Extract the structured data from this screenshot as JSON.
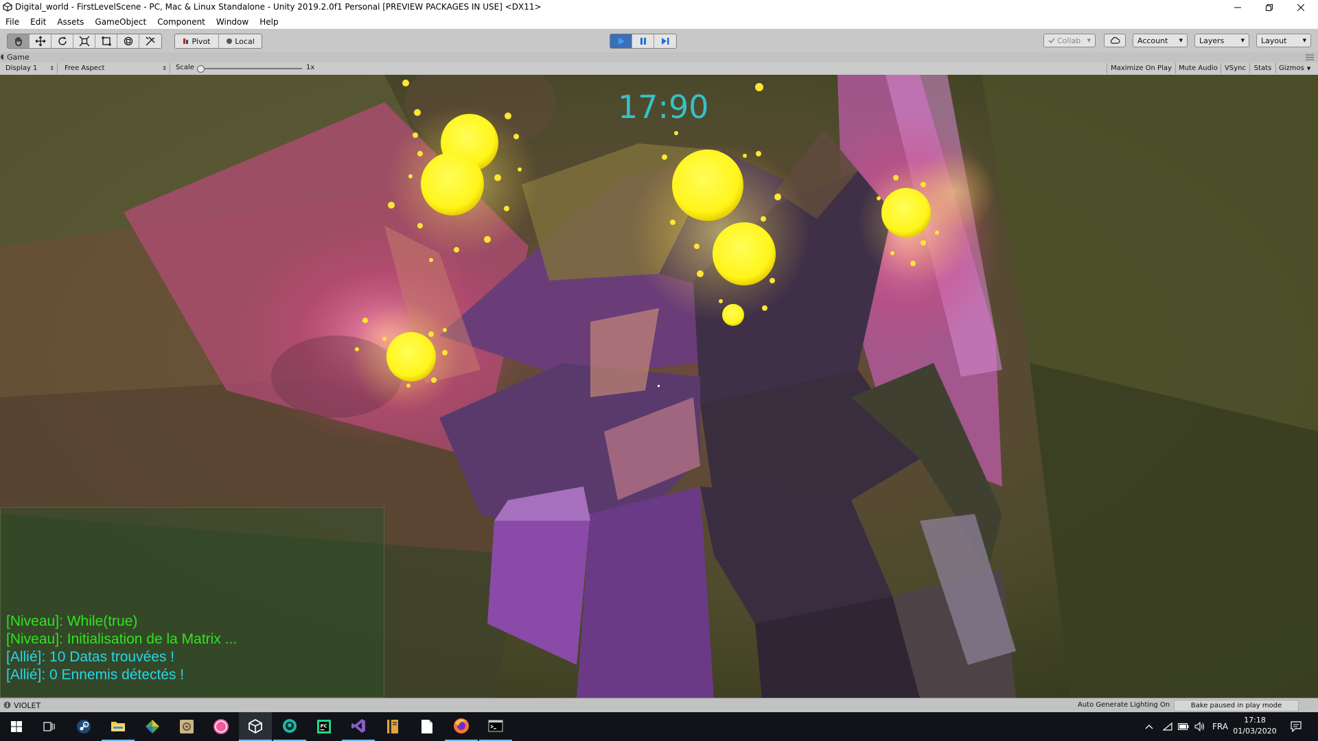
{
  "window": {
    "title": "Digital_world - FirstLevelScene - PC, Mac & Linux Standalone - Unity 2019.2.0f1 Personal [PREVIEW PACKAGES IN USE] <DX11>"
  },
  "menu": [
    "File",
    "Edit",
    "Assets",
    "GameObject",
    "Component",
    "Window",
    "Help"
  ],
  "toolbar": {
    "pivot_label": "Pivot",
    "local_label": "Local",
    "collab_label": "Collab",
    "account_label": "Account",
    "layers_label": "Layers",
    "layout_label": "Layout"
  },
  "game_tab": {
    "label": "Game"
  },
  "game_bar": {
    "display": "Display 1",
    "aspect": "Free Aspect",
    "scale_label": "Scale",
    "scale_value": "1x",
    "scale_level": 0.0,
    "maximize": "Maximize On Play",
    "mute": "Mute Audio",
    "vsync": "VSync",
    "stats": "Stats",
    "gizmos": "Gizmos"
  },
  "game": {
    "timer": "17:90",
    "chat": [
      {
        "text": "[Niveau]: While(true)",
        "color": "#2ee51f"
      },
      {
        "text": "[Niveau]: Initialisation de la Matrix ...",
        "color": "#2ee51f"
      },
      {
        "text": "[Allié]: 10 Datas trouvées !",
        "color": "#27d6e8"
      },
      {
        "text": "[Allié]: 0 Ennemis détectés !",
        "color": "#27d6e8"
      }
    ]
  },
  "status": {
    "message": "VIOLET",
    "lighting": "Auto Generate Lighting On",
    "bake": "Bake paused in play mode"
  },
  "taskbar": {
    "language": "FRA",
    "time": "17:18",
    "date": "01/03/2020"
  }
}
